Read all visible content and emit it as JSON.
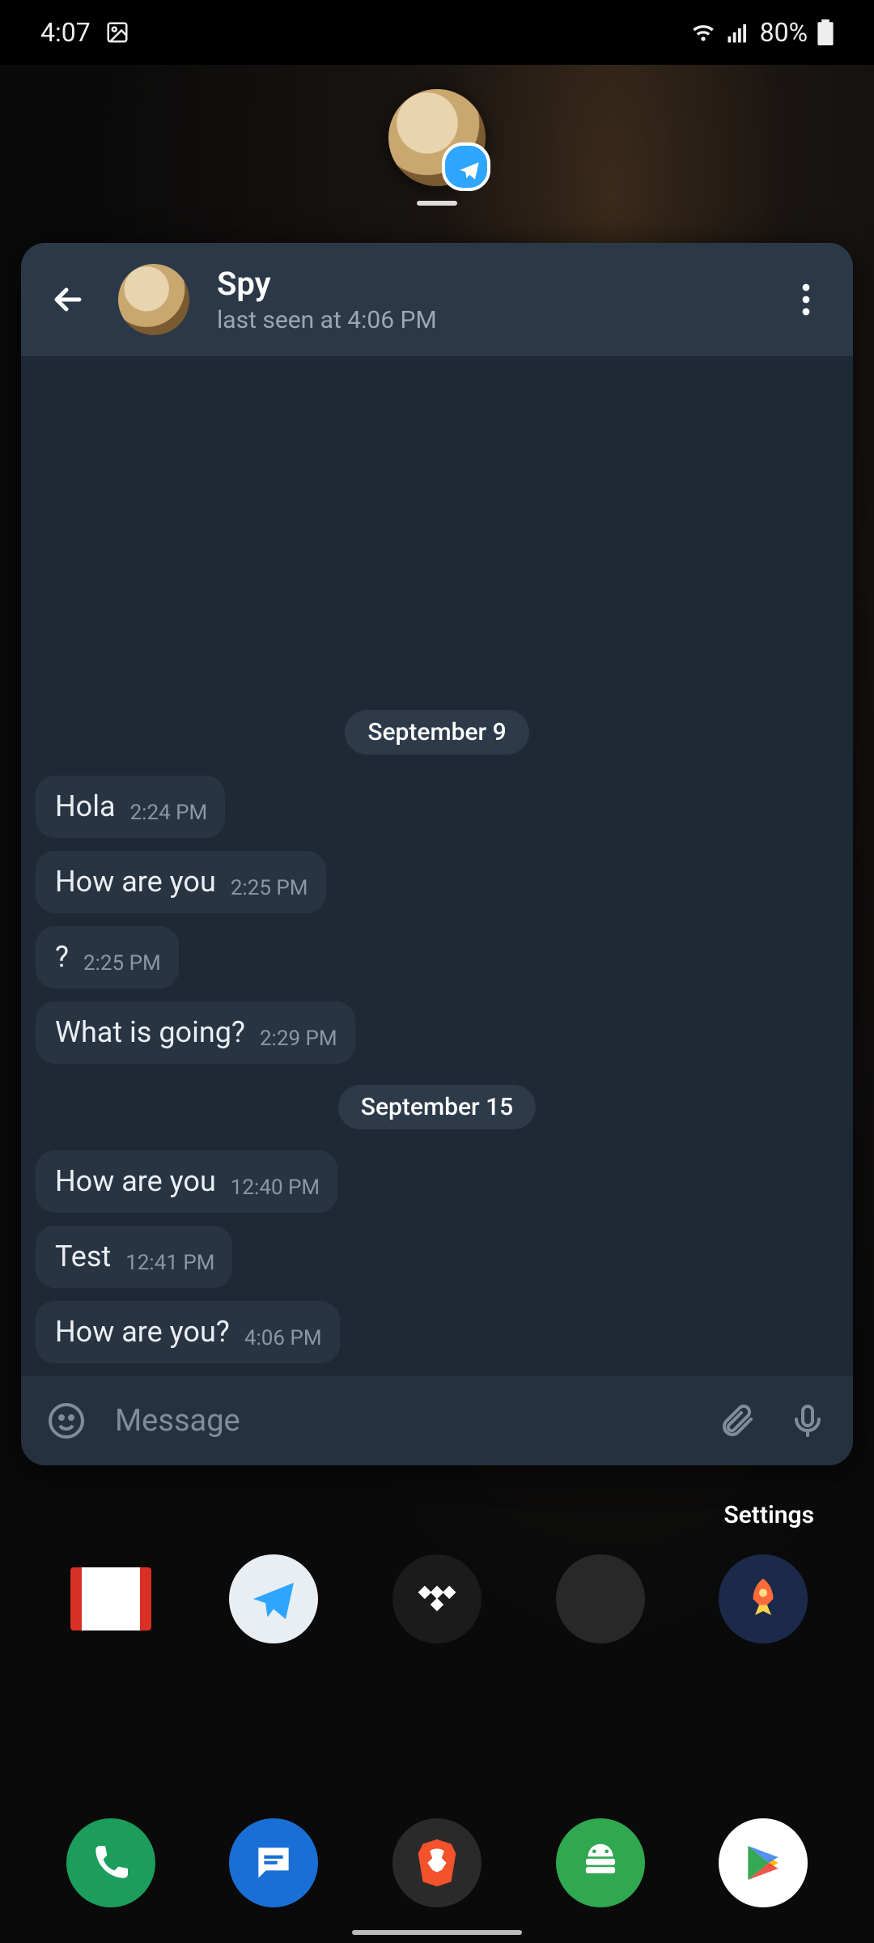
{
  "status": {
    "time": "4:07",
    "battery": "80%"
  },
  "chat": {
    "title": "Spy",
    "subtitle": "last seen at 4:06 PM",
    "input_placeholder": "Message",
    "groups": [
      {
        "date": "September 9",
        "messages": [
          {
            "text": "Hola",
            "time": "2:24 PM"
          },
          {
            "text": "How are you",
            "time": "2:25 PM"
          },
          {
            "text": "?",
            "time": "2:25 PM"
          },
          {
            "text": "What is going?",
            "time": "2:29 PM"
          }
        ]
      },
      {
        "date": "September 15",
        "messages": [
          {
            "text": "How are you",
            "time": "12:40 PM"
          },
          {
            "text": "Test",
            "time": "12:41 PM"
          },
          {
            "text": "How are you?",
            "time": "4:06 PM"
          }
        ]
      }
    ]
  },
  "home": {
    "settings_label": "Settings"
  }
}
